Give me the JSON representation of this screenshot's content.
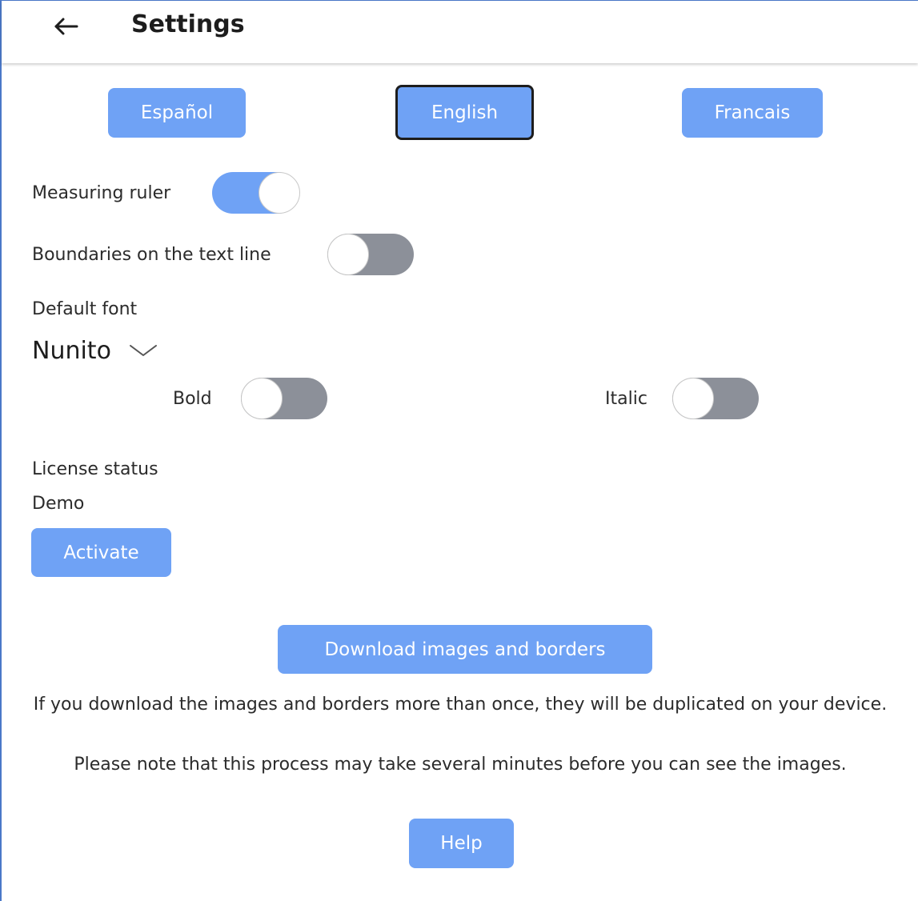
{
  "header": {
    "title": "Settings",
    "back_icon": "arrow-left-icon"
  },
  "languages": {
    "items": [
      {
        "label": "Español",
        "selected": false
      },
      {
        "label": "English",
        "selected": true
      },
      {
        "label": "Francais",
        "selected": false
      }
    ]
  },
  "settings": {
    "measuring_ruler": {
      "label": "Measuring ruler",
      "on": true
    },
    "boundaries": {
      "label": "Boundaries on the text line",
      "on": false
    },
    "default_font_label": "Default font",
    "default_font_value": "Nunito",
    "bold": {
      "label": "Bold",
      "on": false
    },
    "italic": {
      "label": "Italic",
      "on": false
    }
  },
  "license": {
    "label": "License status",
    "value": "Demo",
    "activate_label": "Activate"
  },
  "download": {
    "button_label": "Download images and borders",
    "note_1": "If you download the images and borders more than once, they will be duplicated on your device.",
    "note_2": "Please note that this process may take several minutes before you can see the images."
  },
  "help": {
    "label": "Help"
  },
  "colors": {
    "accent": "#6fa2f5",
    "toggle_off": "#8c9099",
    "text": "#2b2b2b"
  }
}
